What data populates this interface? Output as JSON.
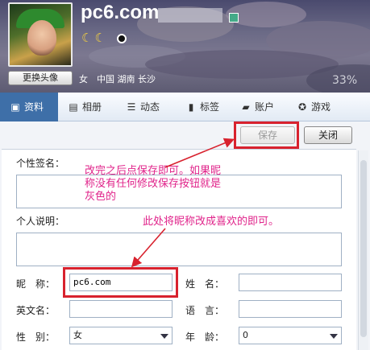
{
  "profile": {
    "username": "pc6.com",
    "change_avatar_label": "更换头像",
    "gender": "女",
    "location": "中国 湖南 长沙",
    "completion": "33%",
    "level_moons": "☾☾"
  },
  "tabs": [
    {
      "label": "资料",
      "icon": "profile-card-icon"
    },
    {
      "label": "相册",
      "icon": "photo-album-icon"
    },
    {
      "label": "动态",
      "icon": "feed-icon"
    },
    {
      "label": "标签",
      "icon": "bookmark-icon"
    },
    {
      "label": "账户",
      "icon": "wallet-icon"
    },
    {
      "label": "游戏",
      "icon": "game-icon"
    }
  ],
  "toolbar": {
    "save_label": "保存",
    "close_label": "关闭"
  },
  "form": {
    "signature_label": "个性签名：",
    "description_label": "个人说明：",
    "nickname_label": "昵　称：",
    "nickname_value": "pc6.com",
    "name_label": "姓　名：",
    "name_value": "",
    "english_name_label": "英文名：",
    "english_name_value": "",
    "language_label": "语　言：",
    "language_value": "",
    "gender_label": "性　别：",
    "gender_value": "女",
    "age_label": "年　龄：",
    "age_value": "0"
  },
  "annotations": {
    "save_note_line1": "改完之后点保存即可。如果昵",
    "save_note_line2": "称没有任何修改保存按钮就是",
    "save_note_line3": "灰色的",
    "nickname_note": "此处将昵称改成喜欢的即可。"
  },
  "colors": {
    "accent_tab": "#3e6fa8",
    "highlight": "#d8222e",
    "annotation": "#e0238a"
  }
}
